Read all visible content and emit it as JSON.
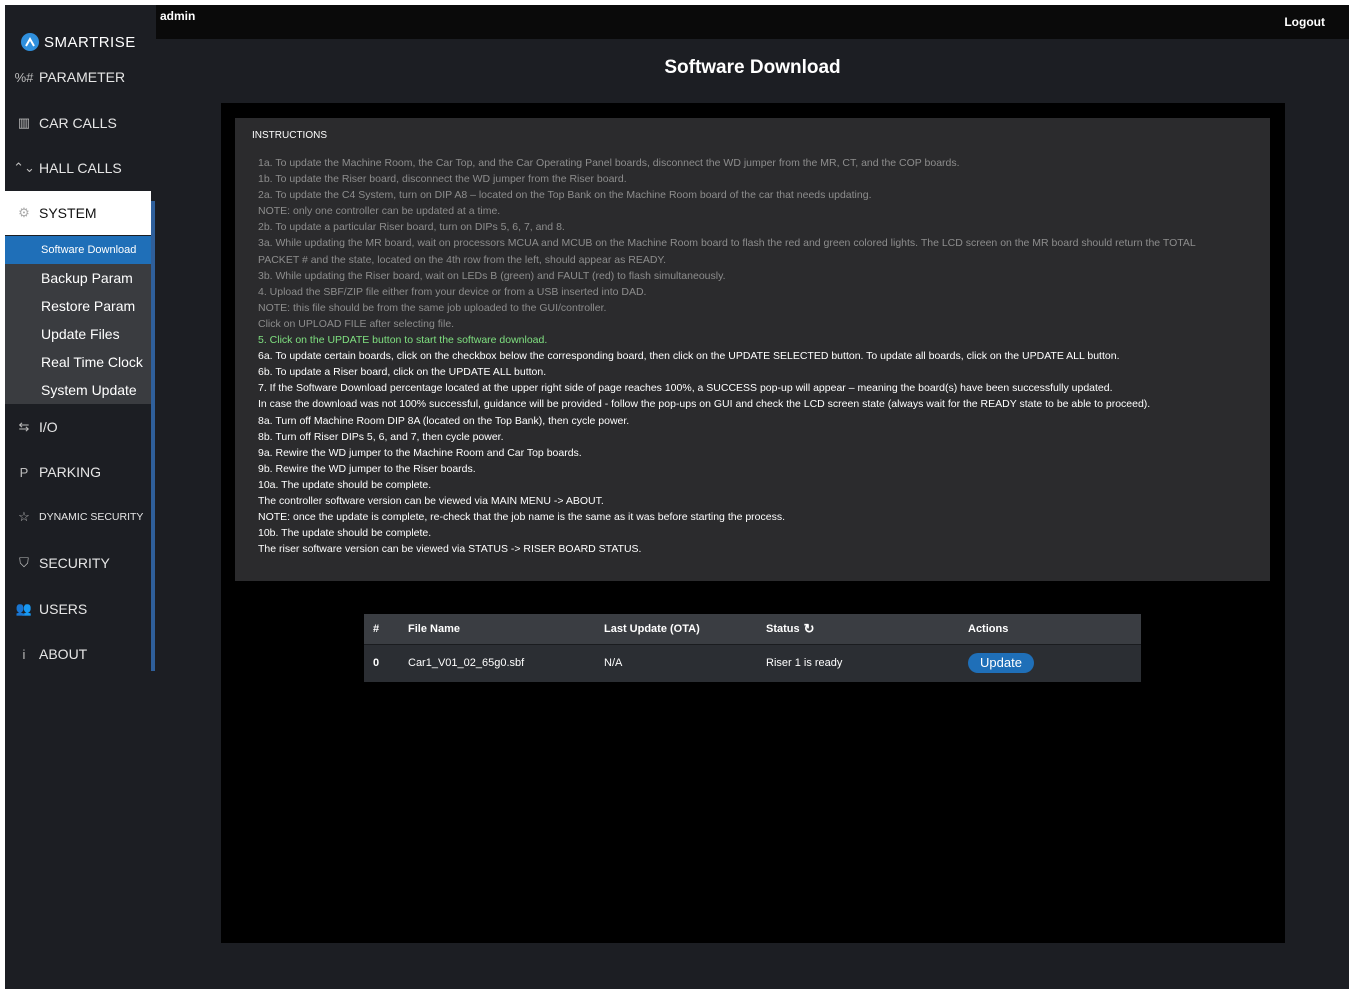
{
  "header": {
    "user": "admin",
    "logout_label": "Logout"
  },
  "brand": {
    "name": "SMARTRISE"
  },
  "sidebar": {
    "items": [
      {
        "label": "PARAMETER",
        "icon": "parameter-icon",
        "glyph": "%#"
      },
      {
        "label": "CAR CALLS",
        "icon": "car-calls-icon",
        "glyph": "▥"
      },
      {
        "label": "HALL CALLS",
        "icon": "hall-calls-icon",
        "glyph": "⌃⌄"
      },
      {
        "label": "SYSTEM",
        "icon": "gear-icon",
        "glyph": "⚙"
      },
      {
        "label": "I/O",
        "icon": "io-arrows-icon",
        "glyph": "⇆"
      },
      {
        "label": "PARKING",
        "icon": "parking-icon",
        "glyph": "P"
      },
      {
        "label": "DYNAMIC SECURITY",
        "icon": "star-icon",
        "glyph": "☆"
      },
      {
        "label": "SECURITY",
        "icon": "shield-icon",
        "glyph": "⛉"
      },
      {
        "label": "USERS",
        "icon": "users-icon",
        "glyph": "👥"
      },
      {
        "label": "ABOUT",
        "icon": "info-icon",
        "glyph": "i"
      }
    ],
    "subitems": [
      {
        "label": "Software Download"
      },
      {
        "label": "Backup Param"
      },
      {
        "label": "Restore Param"
      },
      {
        "label": "Update Files"
      },
      {
        "label": "Real Time Clock"
      },
      {
        "label": "System Update"
      }
    ]
  },
  "page": {
    "title": "Software Download"
  },
  "instructions": {
    "title": "INSTRUCTIONS",
    "lines": [
      {
        "text": "1a. To update the Machine Room, the Car Top, and the Car Operating Panel boards, disconnect the WD jumper from the MR, CT, and the COP boards.",
        "color": "gray"
      },
      {
        "text": "1b. To update the Riser board, disconnect the WD jumper from the Riser board.",
        "color": "gray"
      },
      {
        "text": "2a. To update the C4 System, turn on DIP A8 – located on the Top Bank on the Machine Room board of the car that needs updating.",
        "color": "gray"
      },
      {
        "text": "NOTE: only one controller can be updated at a time.",
        "color": "gray"
      },
      {
        "text": "2b. To update a particular Riser board, turn on DIPs 5, 6, 7, and 8.",
        "color": "gray"
      },
      {
        "text": "3a. While updating the MR board, wait on processors MCUA and MCUB on the Machine Room board to flash the red and green colored lights. The LCD screen on the MR board should return the TOTAL",
        "color": "gray"
      },
      {
        "text": "PACKET # and the state, located on the 4th row from the left, should appear as READY.",
        "color": "gray"
      },
      {
        "text": "3b. While updating the Riser board, wait on LEDs B (green) and FAULT (red) to flash simultaneously.",
        "color": "gray"
      },
      {
        "text": "4. Upload the SBF/ZIP file either from your device or from a USB inserted into DAD.",
        "color": "gray"
      },
      {
        "text": "NOTE: this file should be from the same job uploaded to the GUI/controller.",
        "color": "gray"
      },
      {
        "text": "Click on UPLOAD FILE after selecting file.",
        "color": "gray"
      },
      {
        "text": "5. Click on the UPDATE button to start the software download.",
        "color": "green"
      },
      {
        "text": "6a. To update certain boards, click on the checkbox below the corresponding board, then click on the UPDATE SELECTED button. To update all boards, click on the UPDATE ALL button.",
        "color": "white"
      },
      {
        "text": "6b. To update a Riser board, click on the UPDATE ALL button.",
        "color": "white"
      },
      {
        "text": "7. If the Software Download percentage located at the upper right side of page reaches 100%, a SUCCESS pop-up will appear – meaning the board(s) have been successfully updated.",
        "color": "white"
      },
      {
        "text": "In case the download was not 100% successful, guidance will be provided - follow the pop-ups on GUI and check the LCD screen state (always wait for the READY state to be able to proceed).",
        "color": "white"
      },
      {
        "text": "8a. Turn off Machine Room DIP 8A (located on the Top Bank), then cycle power.",
        "color": "white"
      },
      {
        "text": "8b. Turn off Riser DIPs 5, 6, and 7, then cycle power.",
        "color": "white"
      },
      {
        "text": "9a. Rewire the WD jumper to the Machine Room and Car Top boards.",
        "color": "white"
      },
      {
        "text": "9b. Rewire the WD jumper to the Riser boards.",
        "color": "white"
      },
      {
        "text": "10a. The update should be complete.",
        "color": "white"
      },
      {
        "text": "The controller software version can be viewed via MAIN MENU -> ABOUT.",
        "color": "white"
      },
      {
        "text": "NOTE: once the update is complete, re-check that the job name is the same as it was before starting the process.",
        "color": "white"
      },
      {
        "text": "10b. The update should be complete.",
        "color": "white"
      },
      {
        "text": "The riser software version can be viewed via STATUS -> RISER BOARD STATUS.",
        "color": "white"
      }
    ]
  },
  "table": {
    "headers": {
      "index": "#",
      "file_name": "File Name",
      "last_update": "Last Update (OTA)",
      "status": "Status",
      "actions": "Actions"
    },
    "rows": [
      {
        "index": "0",
        "file_name": "Car1_V01_02_65g0.sbf",
        "last_update": "N/A",
        "status": "Riser 1 is ready",
        "action_label": "Update"
      }
    ]
  },
  "colors": {
    "accent": "#1f6fb8",
    "green_text": "#7fe080",
    "panel_bg": "#2b2b2d",
    "page_bg": "#1c1e23"
  }
}
